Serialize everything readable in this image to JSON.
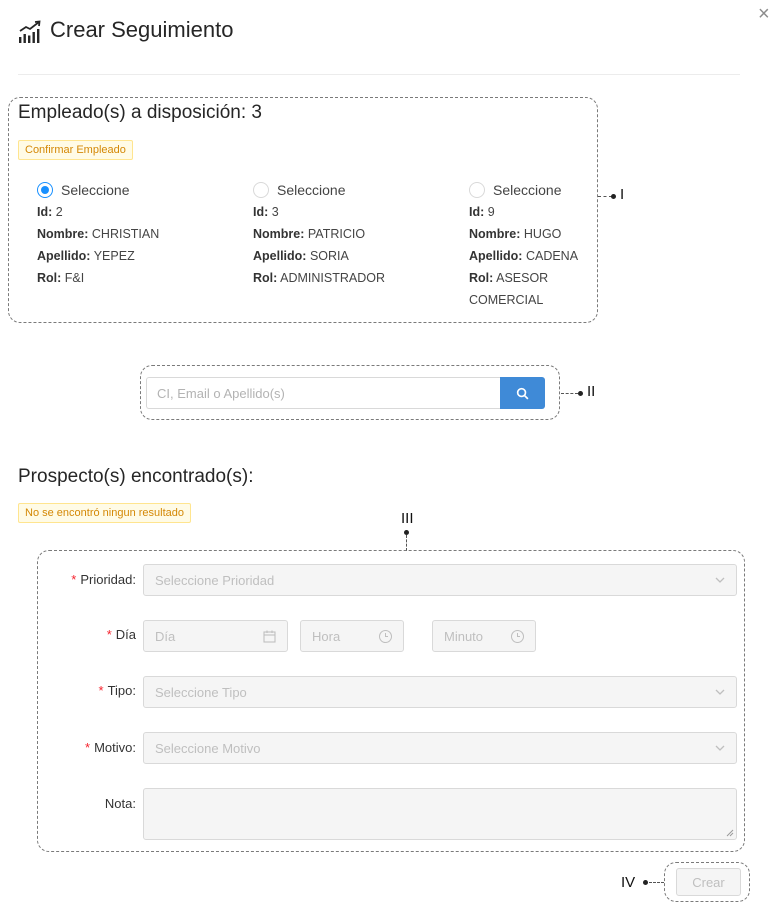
{
  "header": {
    "title": "Crear Seguimiento",
    "icon": "chart-growth-icon",
    "close_icon": "close-icon",
    "close_glyph": "×"
  },
  "employees": {
    "heading": "Empleado(s) a disposición: 3",
    "confirm_tag": "Confirmar Empleado",
    "labels": {
      "id": "Id:",
      "nombre": "Nombre:",
      "apellido": "Apellido:",
      "rol": "Rol:"
    },
    "items": [
      {
        "radio_label": "Seleccione",
        "selected": true,
        "id": "2",
        "nombre": "CHRISTIAN",
        "apellido": "YEPEZ",
        "rol": "F&I"
      },
      {
        "radio_label": "Seleccione",
        "selected": false,
        "id": "3",
        "nombre": "PATRICIO",
        "apellido": "SORIA",
        "rol": "ADMINISTRADOR"
      },
      {
        "radio_label": "Seleccione",
        "selected": false,
        "id": "9",
        "nombre": "HUGO",
        "apellido": "CADENA",
        "rol": "ASESOR COMERCIAL"
      }
    ]
  },
  "search": {
    "placeholder": "CI, Email o Apellido(s)",
    "value": "",
    "button_icon": "search-icon"
  },
  "prospects": {
    "heading": "Prospecto(s) encontrado(s):",
    "empty_tag": "No se encontró ningun resultado"
  },
  "form": {
    "required_mark": "*",
    "prioridad": {
      "label": "Prioridad",
      "placeholder": "Seleccione Prioridad"
    },
    "dia": {
      "label": "Día",
      "date_placeholder": "Día",
      "hour_placeholder": "Hora",
      "minute_placeholder": "Minuto"
    },
    "tipo": {
      "label": "Tipo",
      "placeholder": "Seleccione Tipo"
    },
    "motivo": {
      "label": "Motivo",
      "placeholder": "Seleccione Motivo"
    },
    "nota": {
      "label": "Nota",
      "value": ""
    },
    "colon": ":"
  },
  "actions": {
    "crear": "Crear"
  },
  "annotations": {
    "one": "I",
    "two": "II",
    "three": "III",
    "four": "IV"
  },
  "colors": {
    "primary": "#3f8ad7",
    "radio_active": "#1890ff",
    "warning_text": "#d48806",
    "warning_bg": "#fffbe6",
    "required": "#f5222d"
  }
}
